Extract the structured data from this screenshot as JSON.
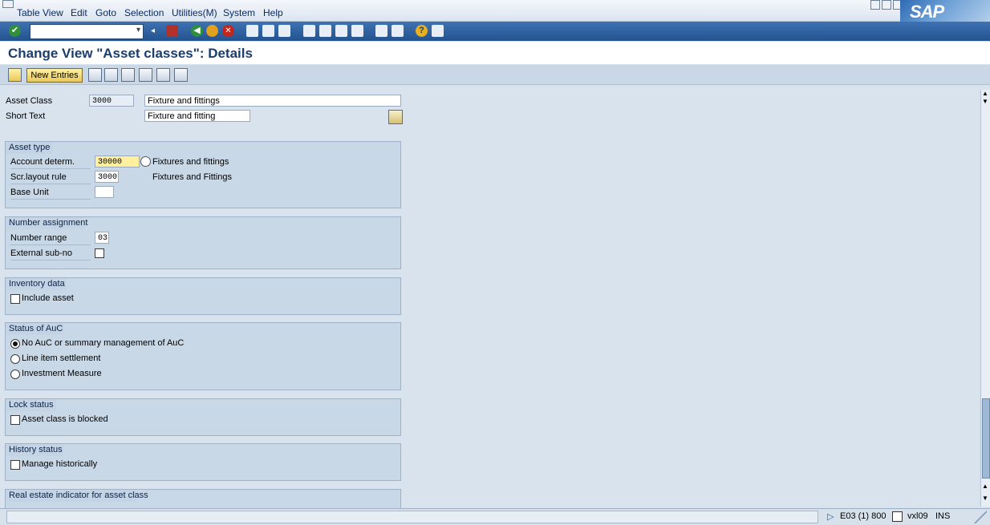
{
  "menu": {
    "items": [
      "Table View",
      "Edit",
      "Goto",
      "Selection",
      "Utilities(M)",
      "System",
      "Help"
    ]
  },
  "branding": {
    "logo_text": "SAP"
  },
  "toolbar": {
    "command_field_value": ""
  },
  "page": {
    "title": "Change View \"Asset classes\": Details"
  },
  "app_toolbar": {
    "new_entries_label": "New Entries"
  },
  "header_fields": {
    "asset_class_label": "Asset Class",
    "asset_class_value": "3000",
    "asset_class_desc": "Fixture and fittings",
    "short_text_label": "Short Text",
    "short_text_value": "Fixture and fitting"
  },
  "groups": {
    "asset_type": {
      "title": "Asset type",
      "account_determ_label": "Account determ.",
      "account_determ_value": "30000",
      "account_determ_desc": "Fixtures and fittings",
      "scr_layout_label": "Scr.layout rule",
      "scr_layout_value": "3000",
      "scr_layout_desc": "Fixtures and Fittings",
      "base_unit_label": "Base Unit",
      "base_unit_value": ""
    },
    "number_assignment": {
      "title": "Number assignment",
      "number_range_label": "Number range",
      "number_range_value": "03",
      "external_subno_label": "External sub-no",
      "external_subno_checked": false
    },
    "inventory": {
      "title": "Inventory data",
      "include_asset_label": "Include asset",
      "include_asset_checked": false
    },
    "auc_status": {
      "title": "Status of AuC",
      "options": [
        {
          "label": "No AuC or summary management of AuC",
          "selected": true
        },
        {
          "label": "Line item settlement",
          "selected": false
        },
        {
          "label": "Investment Measure",
          "selected": false
        }
      ]
    },
    "lock_status": {
      "title": "Lock status",
      "blocked_label": "Asset class is blocked",
      "blocked_checked": false
    },
    "history_status": {
      "title": "History status",
      "manage_label": "Manage historically",
      "manage_checked": false
    },
    "real_estate": {
      "title": "Real estate indicator for asset class"
    }
  },
  "statusbar": {
    "system": "E03 (1) 800",
    "server": "vxl09",
    "mode": "INS"
  },
  "colors": {
    "toolbar_blue": "#2d5f9e",
    "title_blue": "#1a3d6e",
    "group_bg": "#c9d8e7",
    "focus_yellow": "#ffef9f"
  }
}
